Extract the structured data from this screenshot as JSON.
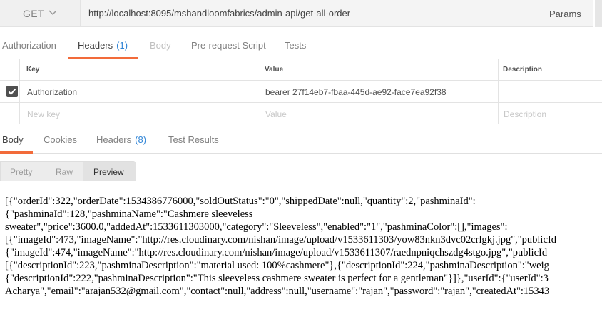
{
  "request": {
    "method": "GET",
    "url": "http://localhost:8095/mshandloomfabrics/admin-api/get-all-order",
    "params_label": "Params"
  },
  "request_tabs": [
    {
      "label": "Authorization",
      "count": ""
    },
    {
      "label": "Headers",
      "count": "(1)"
    },
    {
      "label": "Body",
      "count": ""
    },
    {
      "label": "Pre-request Script",
      "count": ""
    },
    {
      "label": "Tests",
      "count": ""
    }
  ],
  "headers_table": {
    "columns": [
      "Key",
      "Value",
      "Description"
    ],
    "rows": [
      {
        "key": "Authorization",
        "value": "bearer 27f14eb7-fbaa-445d-ae92-face7ea92f38",
        "description": ""
      }
    ],
    "new_row": {
      "key_placeholder": "New key",
      "value_placeholder": "Value",
      "description_placeholder": "Description"
    }
  },
  "response_tabs": [
    {
      "label": "Body",
      "count": ""
    },
    {
      "label": "Cookies",
      "count": ""
    },
    {
      "label": "Headers",
      "count": "(8)"
    },
    {
      "label": "Test Results",
      "count": ""
    }
  ],
  "view_modes": [
    "Pretty",
    "Raw",
    "Preview"
  ],
  "active_view": "Preview",
  "response_body_lines": [
    "[{\"orderId\":322,\"orderDate\":1534386776000,\"soldOutStatus\":\"0\",\"shippedDate\":null,\"quantity\":2,\"pashminaId\":",
    "{\"pashminaId\":128,\"pashminaName\":\"Cashmere sleeveless",
    "sweater\",\"price\":3600.0,\"addedAt\":1533611303000,\"category\":\"Sleeveless\",\"enabled\":\"1\",\"pashminaColor\":[],\"images\":",
    "[{\"imageId\":473,\"imageName\":\"http://res.cloudinary.com/nishan/image/upload/v1533611303/yow83nkn3dvc02crlgkj.jpg\",\"publicId",
    "{\"imageId\":474,\"imageName\":\"http://res.cloudinary.com/nishan/image/upload/v1533611307/raednpniqchszdg4stgo.jpg\",\"publicId",
    "[{\"descriptionId\":223,\"pashminaDescription\":\"material used: 100%cashmere\"},{\"descriptionId\":224,\"pashminaDescription\":\"weig",
    "{\"descriptionId\":222,\"pashminaDescription\":\"This sleeveless cashmere sweater is perfect for a gentleman\"}]},\"userId\":{\"userId\":3",
    "Acharya\",\"email\":\"arajan532@gmail.com\",\"contact\":null,\"address\":null,\"username\":\"rajan\",\"password\":\"rajan\",\"createdAt\":15343"
  ]
}
